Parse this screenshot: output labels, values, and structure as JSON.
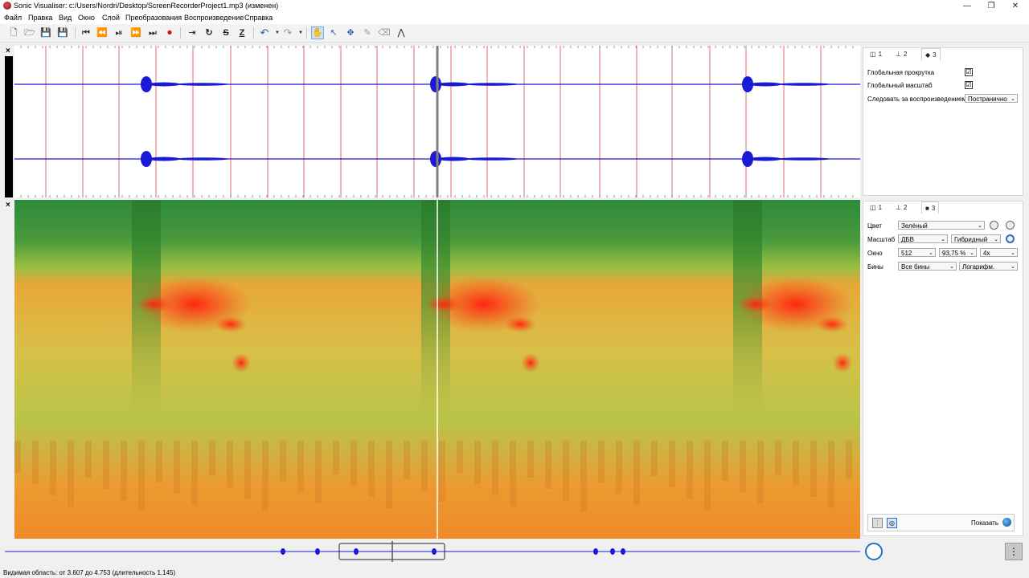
{
  "window": {
    "title": "Sonic Visualiser: c:/Users/Nordri/Desktop/ScreenRecorderProject1.mp3 (изменен)",
    "minimize": "—",
    "maximize": "❐",
    "close": "✕"
  },
  "menu": [
    "Файл",
    "Правка",
    "Вид",
    "Окно",
    "Слой",
    "Преобразования",
    "Воспроизведение",
    "Справка"
  ],
  "toolbar": {
    "icons": [
      "new-file-icon",
      "open-folder-icon",
      "save-icon",
      "save-as-icon",
      "rewind-start-icon",
      "rewind-icon",
      "play-pause-icon",
      "fast-forward-icon",
      "ffwd-end-icon",
      "record-icon",
      "play-selection-icon",
      "loop-icon",
      "solo-icon",
      "follow-icon",
      "undo-icon",
      "redo-icon",
      "navigate-icon",
      "select-icon",
      "move-icon",
      "draw-icon",
      "erase-icon",
      "measure-icon"
    ],
    "glyphs": {
      "new": "🗋",
      "open": "🗁",
      "save": "💾",
      "saveas": "💾",
      "start": "⏮",
      "rew": "⏪",
      "playpause": "⏯",
      "ffwd": "⏩",
      "end": "⏭",
      "record": "⏺",
      "playsel": "⇥",
      "loop": "↻",
      "solo": "S",
      "follow": "Z",
      "undo": "↶",
      "redo": "↷",
      "navigate": "✋",
      "select": "↖",
      "move": "✥",
      "draw": "✎",
      "erase": "⌫",
      "measure": "⋀"
    }
  },
  "panes": {
    "close_glyph": "×"
  },
  "layer_panel_top": {
    "tabs": [
      {
        "icon": "◫",
        "label": "1"
      },
      {
        "icon": "⊥",
        "label": "2"
      },
      {
        "icon": "◆",
        "label": "3"
      }
    ],
    "global_scroll_label": "Глобальная прокрутка",
    "global_scroll_checked": "☑",
    "global_zoom_label": "Глобальный масштаб",
    "global_zoom_checked": "☑",
    "follow_label": "Следовать за воспроизведением",
    "follow_value": "Постранично"
  },
  "layer_panel_bottom": {
    "tabs": [
      {
        "icon": "◫",
        "label": "1"
      },
      {
        "icon": "⊥",
        "label": "2"
      },
      {
        "icon": "■",
        "label": "3"
      }
    ],
    "color_label": "Цвет",
    "color_value": "Зелёный",
    "scale_label": "Масштаб",
    "scale_value": "ДБВ",
    "scale_mode": "Гибридный",
    "window_label": "Окно",
    "window_size": "512",
    "window_overlap": "93,75 %",
    "window_oversample": "4x",
    "bins_label": "Бины",
    "bins_value": "Все бины",
    "bins_scale": "Логарифм.",
    "show_label": "Показать"
  },
  "status": {
    "text": "Видимая область: от 3.607 до 4.753 (длительность 1.145)"
  },
  "colors": {
    "waveform": "#1a1ad4",
    "beat_line": "#d44a4a",
    "playhead": "#808080"
  }
}
